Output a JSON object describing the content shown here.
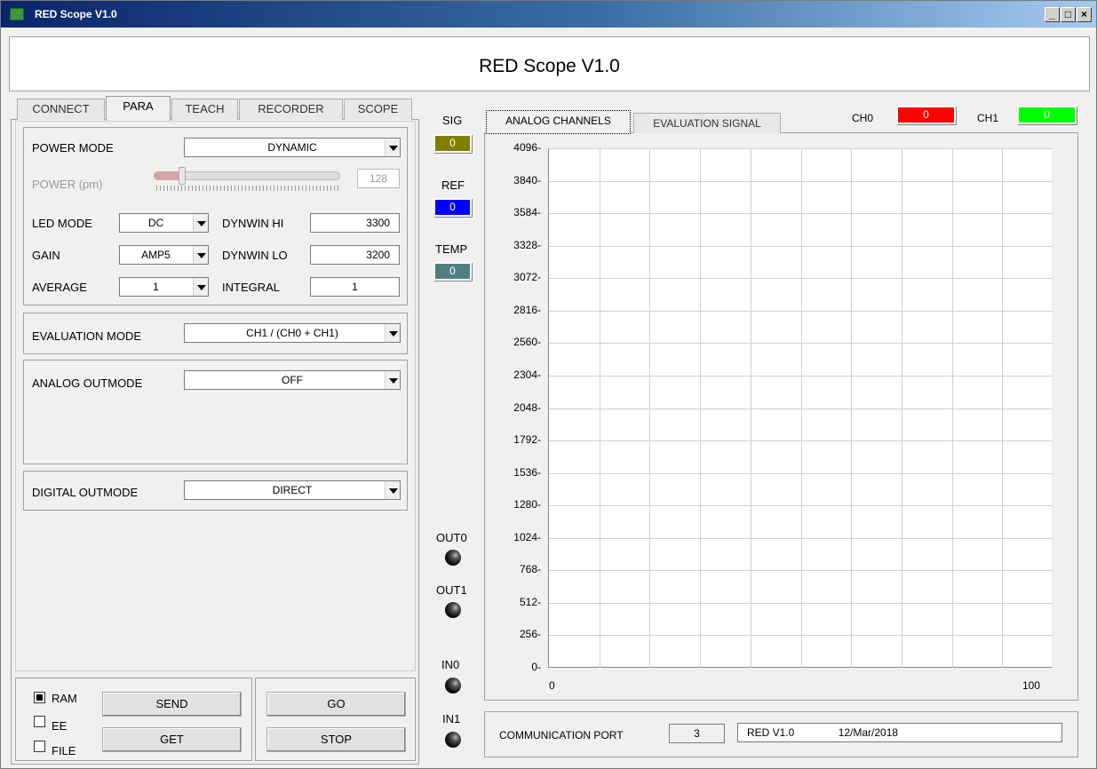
{
  "window": {
    "title": "RED Scope V1.0",
    "controls": [
      "_",
      "□",
      "×"
    ]
  },
  "header": {
    "title": "RED Scope V1.0"
  },
  "tabs": [
    "CONNECT",
    "PARA",
    "TEACH",
    "RECORDER",
    "SCOPE"
  ],
  "active_tab": "PARA",
  "params": {
    "power_mode_label": "POWER MODE",
    "power_mode_value": "DYNAMIC",
    "power_label": "POWER (pm)",
    "power_value": "128",
    "led_mode_label": "LED MODE",
    "led_mode_value": "DC",
    "gain_label": "GAIN",
    "gain_value": "AMP5",
    "average_label": "AVERAGE",
    "average_value": "1",
    "dynwin_hi_label": "DYNWIN HI",
    "dynwin_hi_value": "3300",
    "dynwin_lo_label": "DYNWIN LO",
    "dynwin_lo_value": "3200",
    "integral_label": "INTEGRAL",
    "integral_value": "1",
    "evaluation_mode_label": "EVALUATION MODE",
    "evaluation_mode_value": "CH1 / (CH0 + CH1)",
    "analog_outmode_label": "ANALOG OUTMODE",
    "analog_outmode_value": "OFF",
    "digital_outmode_label": "DIGITAL OUTMODE",
    "digital_outmode_value": "DIRECT"
  },
  "storage": {
    "ram": "RAM",
    "ee": "EE",
    "file": "FILE",
    "ram_checked": true
  },
  "buttons": {
    "send": "SEND",
    "get": "GET",
    "go": "GO",
    "stop": "STOP"
  },
  "indicators": {
    "sig_label": "SIG",
    "sig_value": "0",
    "sig_color": "#808000",
    "ref_label": "REF",
    "ref_value": "0",
    "ref_color": "#0000ff",
    "temp_label": "TEMP",
    "temp_value": "0",
    "temp_color": "#4f8080",
    "out0": "OUT0",
    "out1": "OUT1",
    "in0": "IN0",
    "in1": "IN1"
  },
  "chart_tabs": [
    "ANALOG CHANNELS",
    "EVALUATION SIGNAL"
  ],
  "channels": {
    "ch0_label": "CH0",
    "ch0_value": "0",
    "ch0_color": "#ff0000",
    "ch1_label": "CH1",
    "ch1_value": "0",
    "ch1_color": "#00ff00"
  },
  "chart_data": {
    "type": "line",
    "series": [],
    "y_ticks": [
      "4096",
      "3840",
      "3584",
      "3328",
      "3072",
      "2816",
      "2560",
      "2304",
      "2048",
      "1792",
      "1536",
      "1280",
      "1024",
      "768",
      "512",
      "256",
      "0"
    ],
    "x_ticks": [
      "0",
      "100"
    ],
    "xlim": [
      0,
      100
    ],
    "ylim": [
      0,
      4096
    ],
    "grid": true
  },
  "status": {
    "comm_label": "COMMUNICATION PORT",
    "port": "3",
    "device": "RED V1.0",
    "date": "12/Mar/2018"
  }
}
